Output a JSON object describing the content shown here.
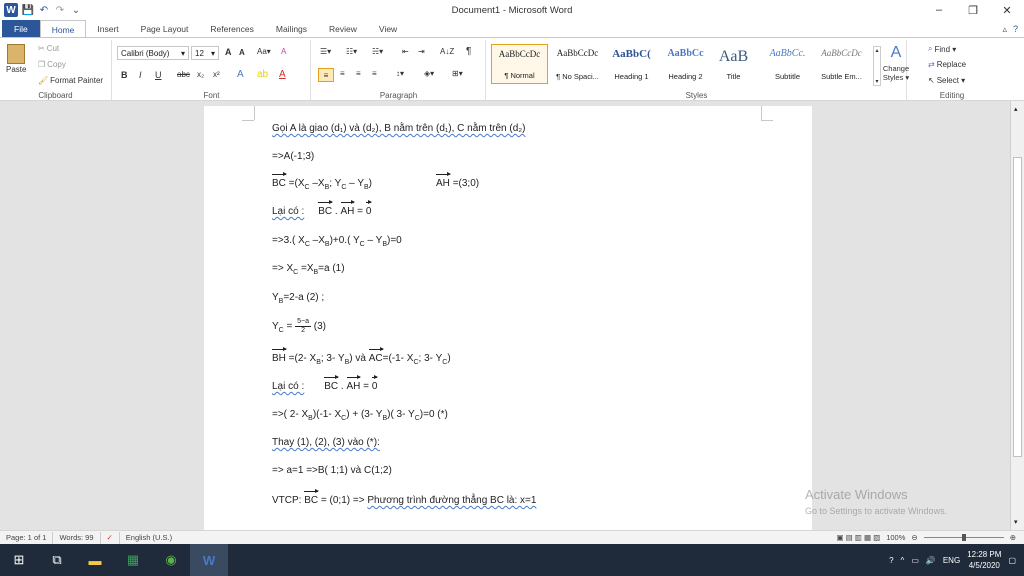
{
  "window": {
    "title": "Document1 - Microsoft Word",
    "minimize": "–",
    "restore": "❐",
    "close": "✕"
  },
  "qat": {
    "word_icon": "W",
    "save": "💾",
    "undo": "↶",
    "redo": "↷",
    "customize": "⌄"
  },
  "tabs": [
    {
      "label": "File"
    },
    {
      "label": "Home"
    },
    {
      "label": "Insert"
    },
    {
      "label": "Page Layout"
    },
    {
      "label": "References"
    },
    {
      "label": "Mailings"
    },
    {
      "label": "Review"
    },
    {
      "label": "View"
    }
  ],
  "tab_right": {
    "minimize_ribbon": "▵",
    "help": "?"
  },
  "clipboard": {
    "paste": "Paste",
    "cut": "Cut",
    "copy": "Copy",
    "format_painter": "Format Painter",
    "label": "Clipboard"
  },
  "font": {
    "name": "Calibri (Body)",
    "size": "12",
    "grow": "A",
    "shrink": "A",
    "bold": "B",
    "italic": "I",
    "underline": "U",
    "strike": "abc",
    "subscript": "x₂",
    "superscript": "x²",
    "clear": "A",
    "label": "Font"
  },
  "paragraph": {
    "label": "Paragraph",
    "show_marks": "¶",
    "sort": "A↓Z"
  },
  "styles": {
    "label": "Styles",
    "items": [
      {
        "preview": "AaBbCcDc",
        "name": "¶ Normal"
      },
      {
        "preview": "AaBbCcDc",
        "name": "¶ No Spaci..."
      },
      {
        "preview": "AaBbC(",
        "name": "Heading 1"
      },
      {
        "preview": "AaBbCc",
        "name": "Heading 2"
      },
      {
        "preview": "AaB",
        "name": "Title"
      },
      {
        "preview": "AaBbCc.",
        "name": "Subtitle"
      },
      {
        "preview": "AaBbCcDc",
        "name": "Subtle Em..."
      }
    ],
    "change": "Change Styles ▾"
  },
  "editing": {
    "find": "Find ▾",
    "replace": "Replace",
    "select": "Select ▾",
    "label": "Editing"
  },
  "doc": {
    "l1": "Gọi A là giao (d₁) và (d₂), B nằm trên (d₁), C nằm trên (d₂)",
    "l2": "=>A(-1;3)",
    "l3a": "BC",
    "l3b": " =(X",
    "l3c": "C",
    "l3d": " –X",
    "l3e": "B",
    "l3f": "; Y",
    "l3g": "C",
    "l3h": " – Y",
    "l3i": "B",
    "l3j": ")",
    "l3k": "AH",
    "l3l": " =(3;0)",
    "l4a": "Lại có :",
    "l4b": "BC",
    "l4c": " . ",
    "l4d": "AH",
    "l4e": "  = ",
    "l4f": "0",
    "l5": "=>3.( X",
    "l5b": "C",
    "l5c": " –X",
    "l5d": "B",
    "l5e": ")+0.( Y",
    "l5f": "C",
    "l5g": " – Y",
    "l5h": "B",
    "l5i": ")=0",
    "l6": "=> X",
    "l6b": "C",
    "l6c": " =X",
    "l6d": "B",
    "l6e": "=a  (1)",
    "l7": "Y",
    "l7b": "B",
    "l7c": "=2-a        (2) ;",
    "l8": "Y",
    "l8b": "C",
    "l8c": " = ",
    "l8num": "5−a",
    "l8den": "2",
    "l8d": "    (3)",
    "l9a": "BH",
    "l9b": " =(2- X",
    "l9c": "B",
    "l9d": "; 3- Y",
    "l9e": "B",
    "l9f": ") và  ",
    "l9g": "AC",
    "l9h": "=(-1- X",
    "l9i": "C",
    "l9j": "; 3- Y",
    "l9k": "C",
    "l9l": ")",
    "l10a": "Lại có :",
    "l10b": "BC",
    "l10c": " . ",
    "l10d": "AH",
    "l10e": "  = ",
    "l10f": "0",
    "l11": "=>( 2- X",
    "l11b": "B",
    "l11c": ")(-1- X",
    "l11d": "C",
    "l11e": ") + (3- Y",
    "l11f": "B",
    "l11g": ")( 3- Y",
    "l11h": "C",
    "l11i": ")=0 (*)",
    "l12": "Thay (1), (2), (3) vào (*):",
    "l13": "=> a=1    =>B( 1;1) và C(1;2)",
    "l14a": "VTCP:    ",
    "l14b": "BC",
    "l14c": " = (0;1)     => ",
    "l14d": "Phương trình đường thẳng BC là: x=1"
  },
  "watermark": {
    "title": "Activate Windows",
    "sub": "Go to Settings to activate Windows."
  },
  "status": {
    "page": "Page: 1 of 1",
    "words": "Words: 99",
    "lang": "English (U.S.)",
    "zoom": "100%"
  },
  "taskbar": {
    "time": "12:28 PM",
    "date": "4/5/2020",
    "lang": "ENG"
  }
}
